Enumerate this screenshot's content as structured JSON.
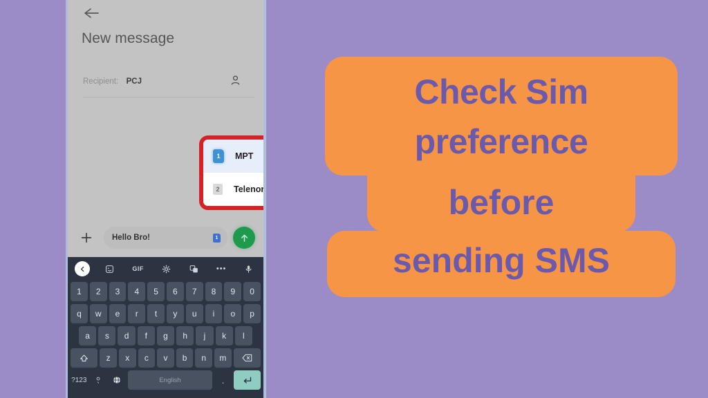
{
  "background_color": "#9b8bc6",
  "headline": {
    "accent_color": "#f79546",
    "text_color": "#6b5aab",
    "lines": [
      "Check Sim",
      "preference",
      "before",
      "sending SMS"
    ],
    "full_text": "Check Sim preference before sending SMS"
  },
  "phone": {
    "app": {
      "back_icon": "arrow-left-icon",
      "title": "New message",
      "recipient": {
        "label": "Recipient:",
        "value": "PCJ",
        "contact_icon": "person-icon"
      },
      "sim_dropdown": {
        "highlight_color": "#d42326",
        "options": [
          {
            "slot": "1",
            "name": "MPT",
            "selected": true,
            "check_icon": "check-icon"
          },
          {
            "slot": "2",
            "name": "Telenor",
            "selected": false,
            "check_icon": ""
          }
        ]
      },
      "compose": {
        "attach_icon": "plus-icon",
        "message_text": "Hello Bro!",
        "sim_indicator": "1",
        "send_icon": "arrow-up-icon",
        "send_color": "#1d9a4e"
      }
    },
    "keyboard": {
      "toolbar": [
        {
          "icon": "chevron-left-icon",
          "label": ""
        },
        {
          "icon": "sticker-icon",
          "label": ""
        },
        {
          "icon": "gif-icon",
          "label": "GIF"
        },
        {
          "icon": "gear-icon",
          "label": ""
        },
        {
          "icon": "translate-icon",
          "label": ""
        },
        {
          "icon": "more-icon",
          "label": "•••"
        },
        {
          "icon": "microphone-icon",
          "label": ""
        }
      ],
      "rows": {
        "numbers": [
          "1",
          "2",
          "3",
          "4",
          "5",
          "6",
          "7",
          "8",
          "9",
          "0"
        ],
        "letters_top": [
          "q",
          "w",
          "e",
          "r",
          "t",
          "y",
          "u",
          "i",
          "o",
          "p"
        ],
        "letters_mid": [
          "a",
          "s",
          "d",
          "f",
          "g",
          "h",
          "j",
          "k",
          "l"
        ],
        "letters_bottom": [
          "z",
          "x",
          "c",
          "v",
          "b",
          "n",
          "m"
        ],
        "shift_icon": "shift-icon",
        "backspace_icon": "backspace-icon"
      },
      "bottom_row": {
        "symbols_key": "?123",
        "emoji_icon": "emoji-comma-icon",
        "globe_icon": "globe-icon",
        "space_label": "English",
        "period_key": ".",
        "enter_icon": "enter-icon"
      }
    }
  }
}
